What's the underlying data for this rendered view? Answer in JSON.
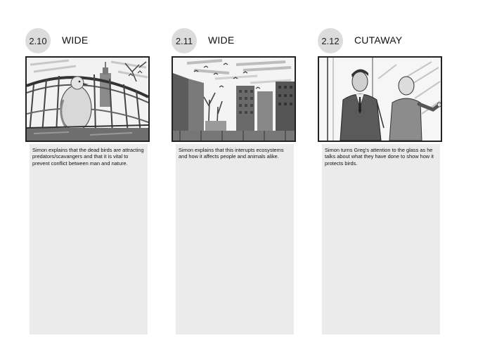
{
  "panels": [
    {
      "number": "2.10",
      "shot_type": "WIDE",
      "illustration": "pigeon-on-railing-sketch",
      "description": "Simon explains that the dead birds are attracting predators/scavangers and that it is vital to prevent conflict between man and nature."
    },
    {
      "number": "2.11",
      "shot_type": "WIDE",
      "illustration": "city-skyline-birds-sketch",
      "description": "Simon explains that this interupts ecosystems and how it affects people and animals alike."
    },
    {
      "number": "2.12",
      "shot_type": "CUTAWAY",
      "illustration": "two-men-at-glass-sketch",
      "description": "Simon turns Greg's attention to the glass as he talks about what they have done to show how it protects birds."
    }
  ]
}
